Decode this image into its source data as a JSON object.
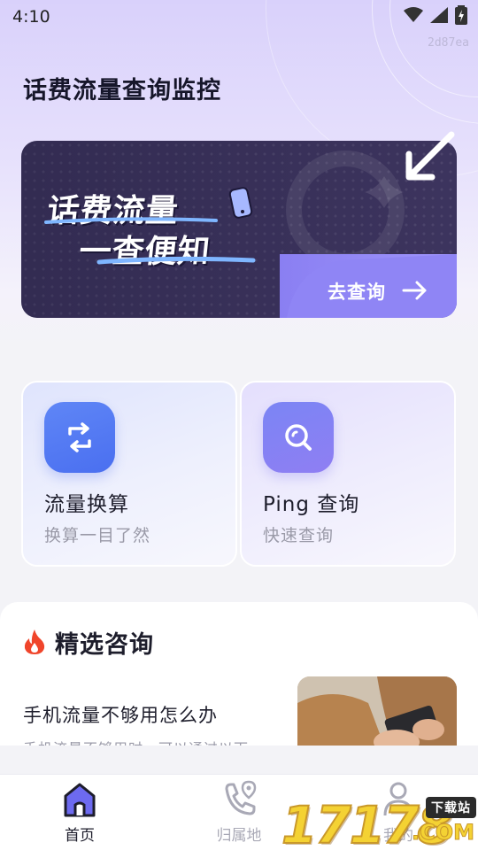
{
  "status_bar": {
    "time": "4:10"
  },
  "tag_code": "2d87ea",
  "app_title": "话费流量查询监控",
  "banner": {
    "line1": "话费流量",
    "line2": "一查便知",
    "cta_label": "去查询"
  },
  "features": [
    {
      "title": "流量换算",
      "subtitle": "换算一目了然",
      "icon": "swap-icon"
    },
    {
      "title": "Ping 查询",
      "subtitle": "快速查询",
      "icon": "magnifier-icon"
    }
  ],
  "featured": {
    "title": "精选咨询",
    "article": {
      "title": "手机流量不够用怎么办",
      "summary": "手机流量不够用时，可以通过以下"
    }
  },
  "bottom_nav": [
    {
      "label": "首页",
      "icon": "home-icon",
      "active": true
    },
    {
      "label": "归属地",
      "icon": "phone-location-icon",
      "active": false
    },
    {
      "label": "我的",
      "icon": "person-icon",
      "active": false
    }
  ],
  "watermark": {
    "digits": "17178",
    "badge": "下载站",
    "suffix": ".COM"
  },
  "colors": {
    "accent": "#7f78ee",
    "primary_blue": "#4a6ff0",
    "banner_dark": "#3a325a"
  }
}
